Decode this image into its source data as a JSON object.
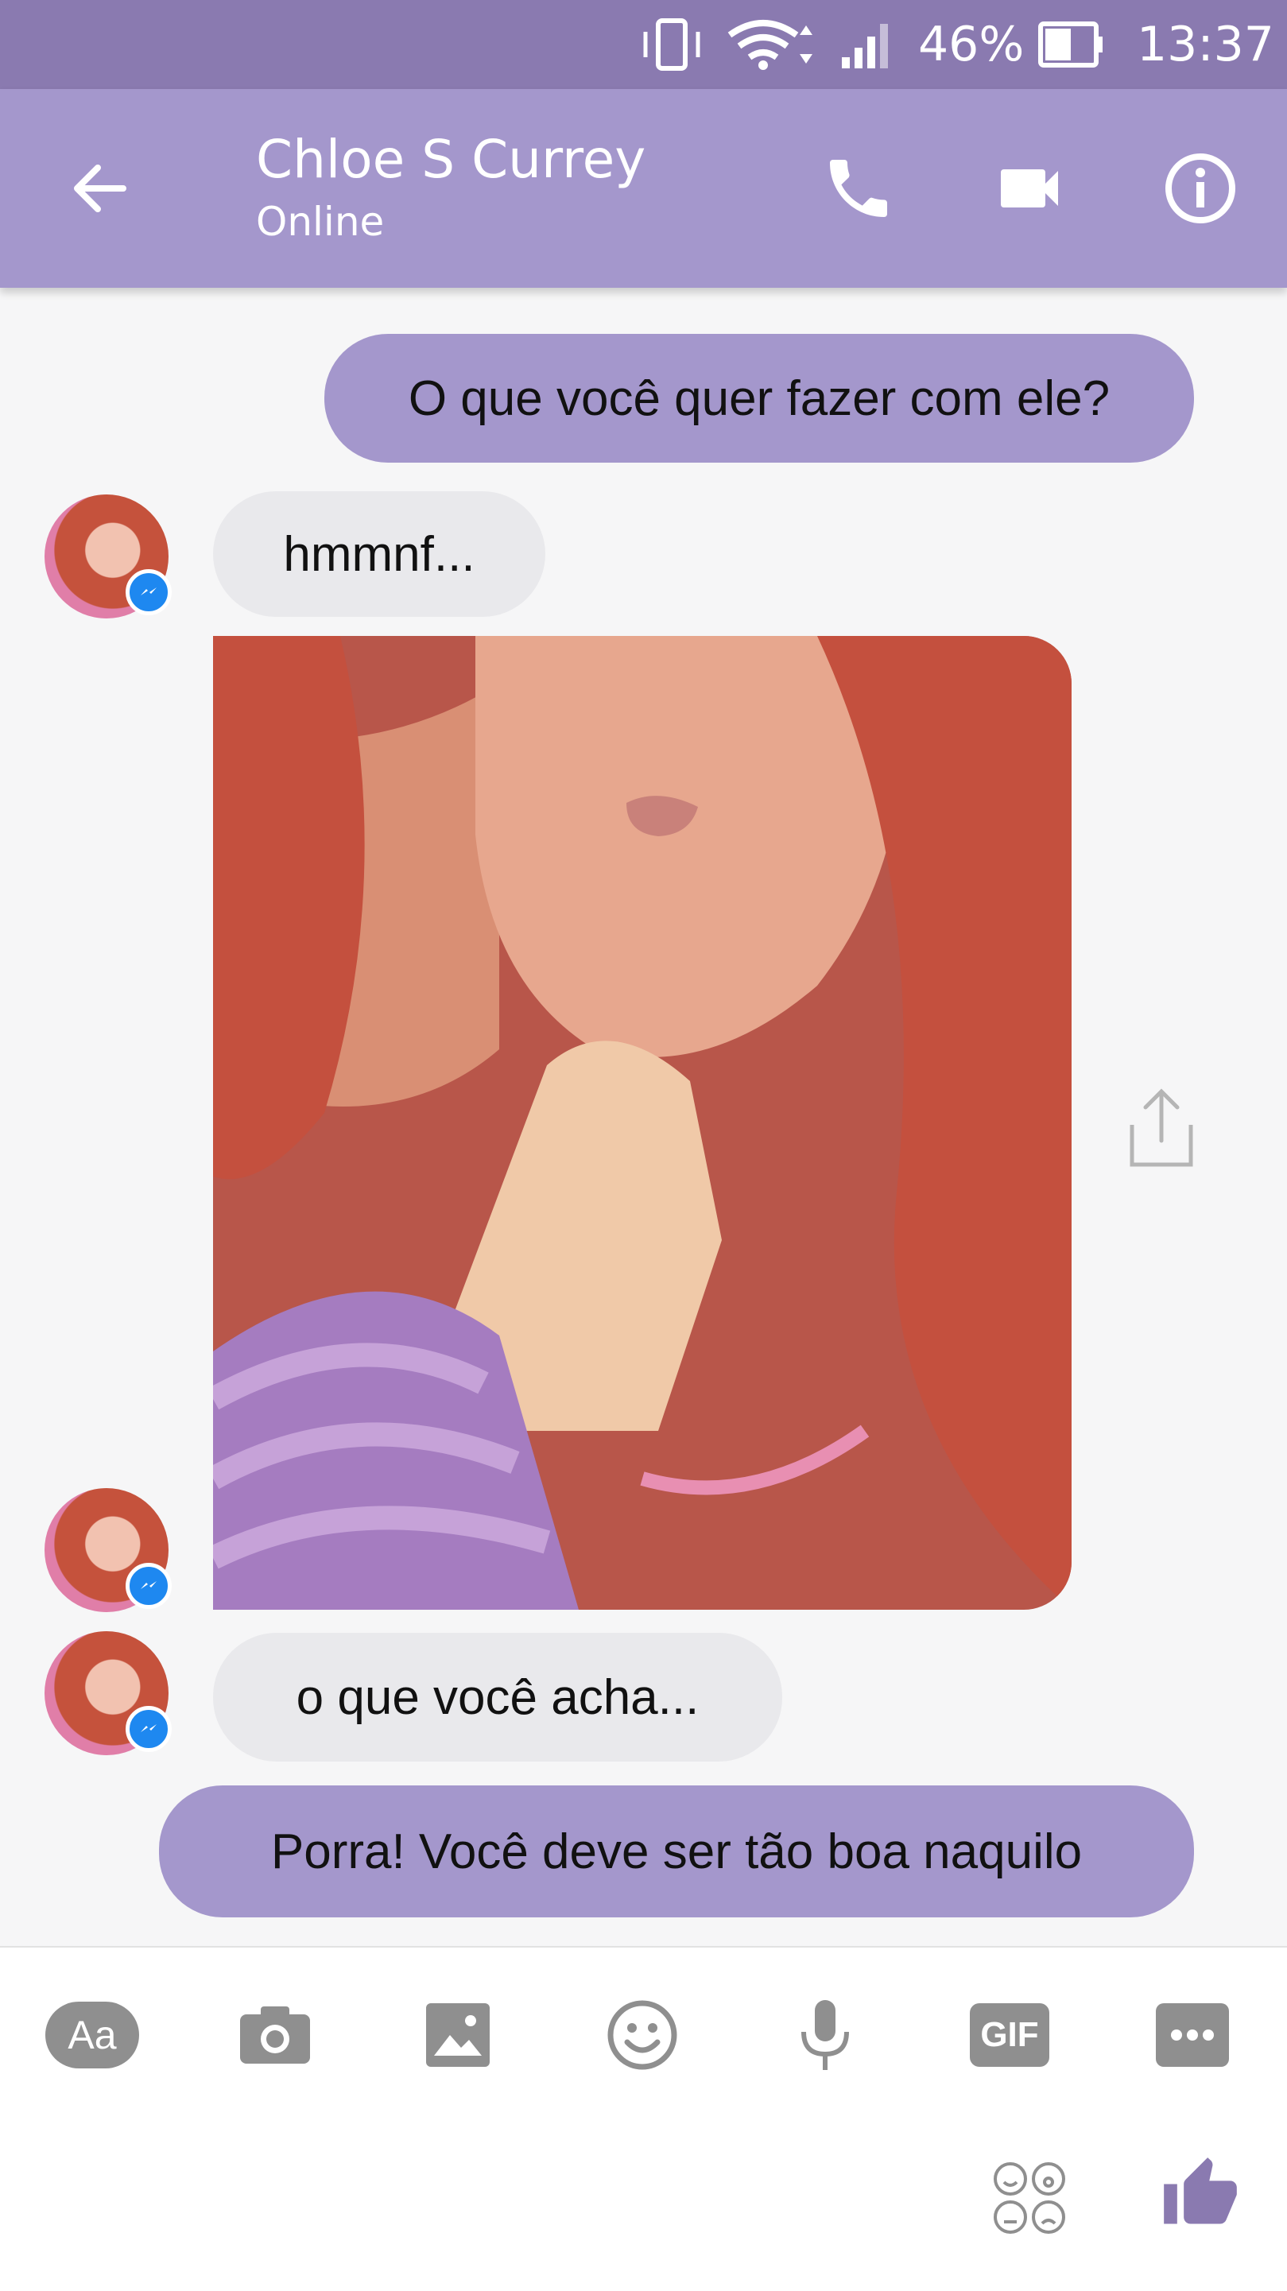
{
  "status_bar": {
    "battery_percent": "46%",
    "time": "13:37"
  },
  "header": {
    "contact_name": "Chloe S Currey",
    "presence": "Online"
  },
  "messages": [
    {
      "from": "me",
      "text": "O que você quer fazer com ele?"
    },
    {
      "from": "them",
      "text": "hmmnf..."
    },
    {
      "from": "them",
      "type": "image",
      "description": "illustration"
    },
    {
      "from": "them",
      "text": "o que você acha..."
    },
    {
      "from": "me",
      "text": "Porra! Você deve ser tão boa naquilo"
    }
  ],
  "composer": {
    "tools": [
      "text-icon",
      "camera-icon",
      "gallery-icon",
      "emoji-icon",
      "microphone-icon",
      "gif-icon",
      "more-icon"
    ],
    "text_tool_label": "Aa",
    "gif_label": "GIF"
  },
  "colors": {
    "accent": "#a497cc",
    "status_bar": "#8a7ab0",
    "incoming_bubble": "#e9e9ec",
    "messenger_badge": "#1e88f0"
  }
}
